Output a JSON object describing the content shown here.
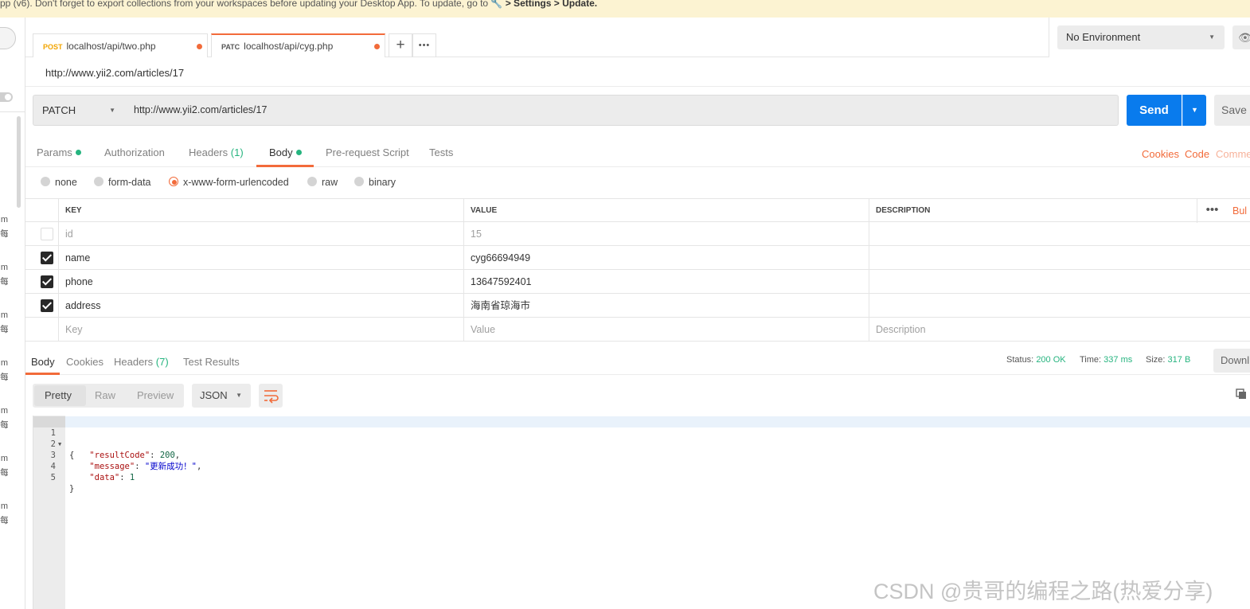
{
  "banner": {
    "text": "pp (v6). Don't forget to export collections from your workspaces before updating your Desktop App. To update, go to",
    "path": "> Settings > Update."
  },
  "sidebar": {
    "glyphs": [
      "m",
      "每",
      "m",
      "每",
      "m",
      "每",
      "m",
      "每",
      "m",
      "每",
      "m",
      "每",
      "m",
      "每"
    ]
  },
  "tabs": [
    {
      "method": "POST",
      "method_color": "#f2a400",
      "label": "localhost/api/two.php"
    },
    {
      "method": "PATC",
      "method_color": "#555555",
      "label": "localhost/api/cyg.php"
    }
  ],
  "tab_actions": {
    "add": "+",
    "more": "•••"
  },
  "environment": {
    "selected": "No Environment"
  },
  "request": {
    "name": "http://www.yii2.com/articles/17",
    "method": "PATCH",
    "url": "http://www.yii2.com/articles/17",
    "send_label": "Send",
    "save_label": "Save"
  },
  "request_tabs": {
    "params": "Params",
    "authorization": "Authorization",
    "headers": "Headers",
    "headers_count": "(1)",
    "body": "Body",
    "prerequest": "Pre-request Script",
    "tests": "Tests",
    "cookies": "Cookies",
    "code": "Code",
    "comments": "Comme"
  },
  "body_types": [
    "none",
    "form-data",
    "x-www-form-urlencoded",
    "raw",
    "binary"
  ],
  "body_type_selected": "x-www-form-urlencoded",
  "kv_table": {
    "headers": {
      "key": "KEY",
      "value": "VALUE",
      "description": "DESCRIPTION"
    },
    "bulk_label": "Bul",
    "more": "•••",
    "rows": [
      {
        "checked": false,
        "key": "id",
        "value": "15",
        "description": ""
      },
      {
        "checked": true,
        "key": "name",
        "value": "cyg66694949",
        "description": ""
      },
      {
        "checked": true,
        "key": "phone",
        "value": "13647592401",
        "description": ""
      },
      {
        "checked": true,
        "key": "address",
        "value": "海南省琼海市",
        "description": ""
      }
    ],
    "placeholder": {
      "key": "Key",
      "value": "Value",
      "description": "Description"
    }
  },
  "response_tabs": {
    "body": "Body",
    "cookies": "Cookies",
    "headers": "Headers",
    "headers_count": "(7)",
    "test_results": "Test Results"
  },
  "response_status": {
    "status_label": "Status:",
    "status_value": "200 OK",
    "time_label": "Time:",
    "time_value": "337 ms",
    "size_label": "Size:",
    "size_value": "317 B",
    "download_label": "Downl"
  },
  "format": {
    "pretty": "Pretty",
    "raw": "Raw",
    "preview": "Preview",
    "language": "JSON"
  },
  "response_body": {
    "line_numbers": [
      "1",
      "2",
      "3",
      "4",
      "5"
    ],
    "open_brace": "{",
    "close_brace": "}",
    "result_code_key": "\"resultCode\"",
    "result_code_value": "200",
    "message_key": "\"message\"",
    "message_value": "\"更新成功！\"",
    "data_key": "\"data\"",
    "data_value": "1"
  },
  "watermark": "CSDN @贵哥的编程之路(热爱分享)"
}
